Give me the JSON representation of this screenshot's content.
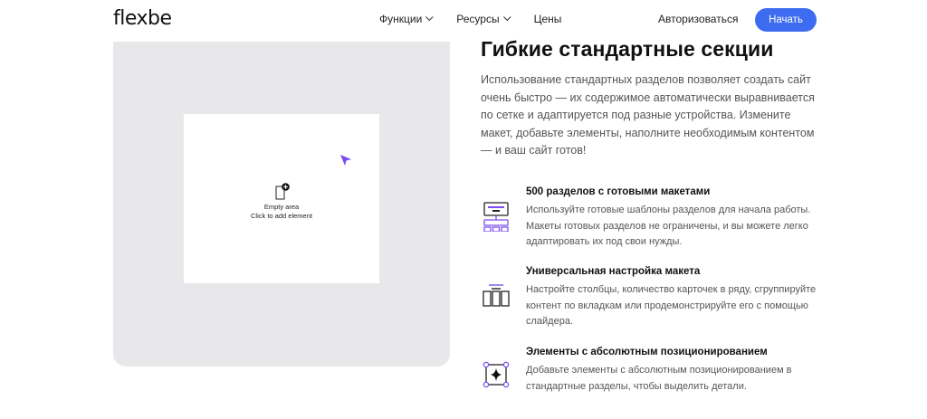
{
  "header": {
    "logo": "flexbe",
    "nav": [
      {
        "label": "Функции",
        "has_dropdown": true
      },
      {
        "label": "Ресурсы",
        "has_dropdown": true
      },
      {
        "label": "Цены",
        "has_dropdown": false
      }
    ],
    "login_label": "Авторизоваться",
    "start_label": "Начать"
  },
  "preview": {
    "empty_title": "Empty area",
    "empty_hint": "Click to add element",
    "cursor_color": "#7b4df0"
  },
  "section": {
    "title": "Гибкие стандартные секции",
    "description": "Использование стандартных разделов позволяет создать сайт очень быстро — их содержимое автоматически выравнивается по сетке и адаптируется под разные устройства. Измените макет, добавьте элементы, наполните необходимым контентом — и ваш сайт готов!"
  },
  "features": [
    {
      "icon": "layout-sections-icon",
      "title": "500 разделов с готовыми макетами",
      "text": "Используйте готовые шаблоны разделов для начала работы. Макеты готовых разделов не ограничены, и вы можете легко адаптировать их под свои нужды."
    },
    {
      "icon": "columns-layout-icon",
      "title": "Универсальная настройка макета",
      "text": "Настройте столбцы, количество карточек в ряду, сгруппируйте контент по вкладкам или продемонстрируйте его с помощью слайдера."
    },
    {
      "icon": "absolute-position-icon",
      "title": "Элементы с абсолютным позиционированием",
      "text": "Добавьте элементы с абсолютным позиционированием в стандартные разделы, чтобы выделить детали."
    }
  ],
  "colors": {
    "accent": "#3d6cf0",
    "purple": "#7b4df0",
    "preview_bg": "#e8e8ea"
  }
}
